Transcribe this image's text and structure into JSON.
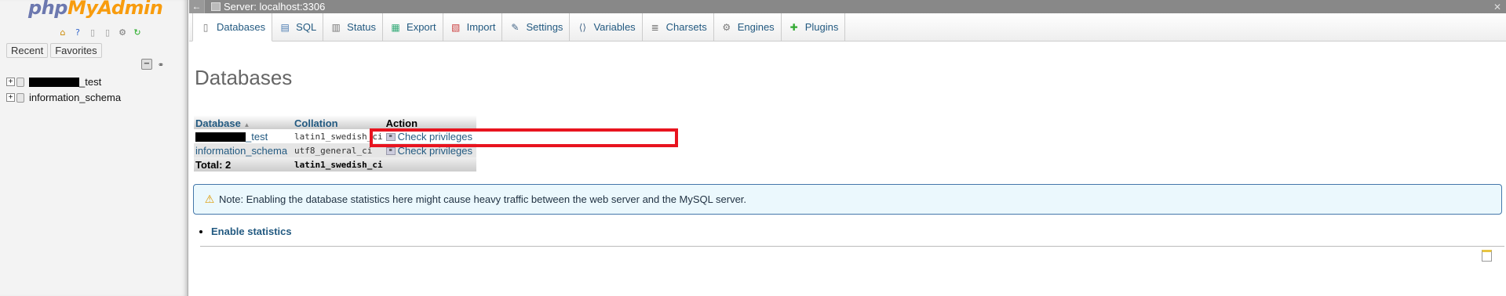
{
  "nav": {
    "logo_php": "php",
    "logo_rest": "MyAdmin",
    "tabs": {
      "recent": "Recent",
      "favorites": "Favorites"
    },
    "tree": [
      {
        "label": "_test",
        "redacted_prefix": true
      },
      {
        "label": "information_schema",
        "redacted_prefix": false
      }
    ]
  },
  "server_bar": {
    "back": "←",
    "label": "Server: localhost:3306",
    "collapse": "✕"
  },
  "tabs": [
    {
      "label": "Databases",
      "icon": "database-icon"
    },
    {
      "label": "SQL",
      "icon": "sql-icon"
    },
    {
      "label": "Status",
      "icon": "status-icon"
    },
    {
      "label": "Export",
      "icon": "export-icon"
    },
    {
      "label": "Import",
      "icon": "import-icon"
    },
    {
      "label": "Settings",
      "icon": "wrench-icon"
    },
    {
      "label": "Variables",
      "icon": "variables-icon"
    },
    {
      "label": "Charsets",
      "icon": "charsets-icon"
    },
    {
      "label": "Engines",
      "icon": "engines-icon"
    },
    {
      "label": "Plugins",
      "icon": "plugins-icon"
    }
  ],
  "main": {
    "title": "Databases",
    "table": {
      "headers": {
        "database": "Database",
        "collation": "Collation",
        "action": "Action"
      },
      "rows": [
        {
          "name": "_test",
          "redacted_prefix": true,
          "collation": "latin1_swedish_ci",
          "action": "Check privileges"
        },
        {
          "name": "information_schema",
          "redacted_prefix": false,
          "collation": "utf8_general_ci",
          "action": "Check privileges"
        }
      ],
      "total_label": "Total: 2",
      "total_collation": "latin1_swedish_ci"
    },
    "notice": "Note: Enabling the database statistics here might cause heavy traffic between the web server and the MySQL server.",
    "enable_statistics": "Enable statistics"
  },
  "colors": {
    "link": "#235a81",
    "highlight": "#e8141f",
    "logo_php": "#6c78af",
    "logo_rest": "#f89c0e"
  }
}
